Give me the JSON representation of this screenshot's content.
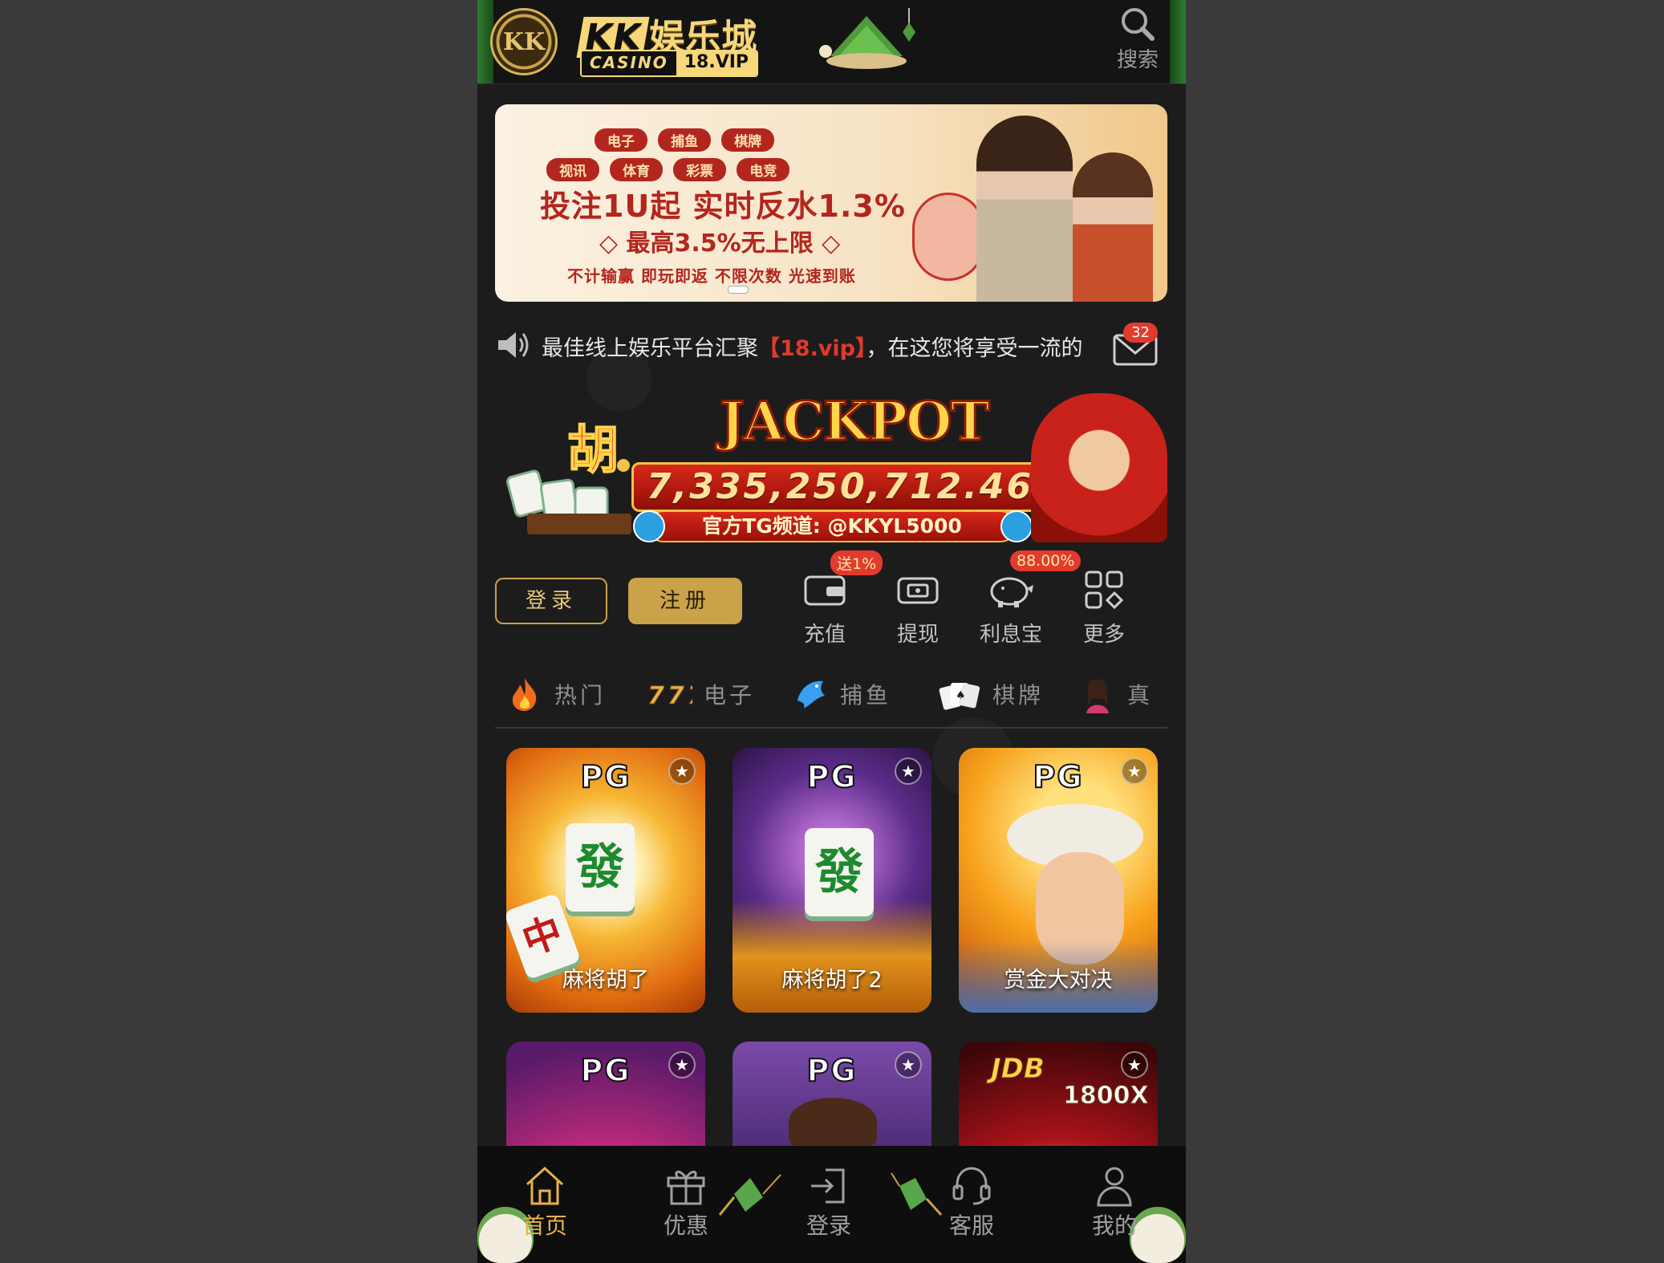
{
  "header": {
    "logo_badge": "KK",
    "brand_kk": "KK",
    "brand_name": "娱乐城",
    "brand_casino": "CASINO",
    "brand_domain": "18.VIP",
    "search_label": "搜索"
  },
  "banner": {
    "pills_row1": [
      "电子",
      "捕鱼",
      "棋牌"
    ],
    "pills_row2": [
      "视讯",
      "体育",
      "彩票",
      "电竞"
    ],
    "line1": "投注1U起 实时反水1.3%",
    "line2": "◇ 最高3.5%无上限 ◇",
    "line3": "不计输赢 即玩即返 不限次数 光速到账",
    "accent": "#b3261e"
  },
  "marquee": {
    "text_before": "最佳线上娱乐平台汇聚",
    "text_vip": "【18.vip】",
    "text_after": "，在这您将享受一流的",
    "mail_count": "32"
  },
  "jackpot": {
    "title": "JACKPOT",
    "hu": "胡",
    "value": "7,335,250,712.46",
    "tg": "官方TG频道: @KKYL5000"
  },
  "auth": {
    "login": "登录",
    "register": "注册"
  },
  "quick_actions": [
    {
      "label": "充值",
      "badge": "送1%",
      "icon": "wallet-icon"
    },
    {
      "label": "提现",
      "badge": "",
      "icon": "withdraw-icon"
    },
    {
      "label": "利息宝",
      "badge": "88.00%",
      "icon": "piggy-bank-icon"
    },
    {
      "label": "更多",
      "badge": "",
      "icon": "grid-more-icon"
    }
  ],
  "tabs": [
    {
      "label": "热门",
      "icon": "fire-icon"
    },
    {
      "label": "电子",
      "icon": "777-icon"
    },
    {
      "label": "捕鱼",
      "icon": "fish-icon"
    },
    {
      "label": "棋牌",
      "icon": "cards-icon"
    },
    {
      "label": "真",
      "icon": "live-dealer-icon"
    }
  ],
  "games": [
    {
      "provider": "PG",
      "name": "麻将胡了"
    },
    {
      "provider": "PG",
      "name": "麻将胡了2"
    },
    {
      "provider": "PG",
      "name": "赏金大对决"
    },
    {
      "provider": "PG",
      "name": ""
    },
    {
      "provider": "PG",
      "name": ""
    },
    {
      "provider": "JDB",
      "name": "",
      "extra": "1800X"
    }
  ],
  "tile_char": "發",
  "tile_char2": "中",
  "bottom_nav": [
    {
      "label": "首页",
      "icon": "home-icon",
      "active": true
    },
    {
      "label": "优惠",
      "icon": "gift-icon"
    },
    {
      "label": "登录",
      "icon": "login-icon"
    },
    {
      "label": "客服",
      "icon": "headset-icon"
    },
    {
      "label": "我的",
      "icon": "user-icon"
    }
  ],
  "colors": {
    "gold": "#c9a24a",
    "background": "#1c1c1c",
    "active_nav": "#e8b24a",
    "badge_red": "#e23b2e"
  }
}
